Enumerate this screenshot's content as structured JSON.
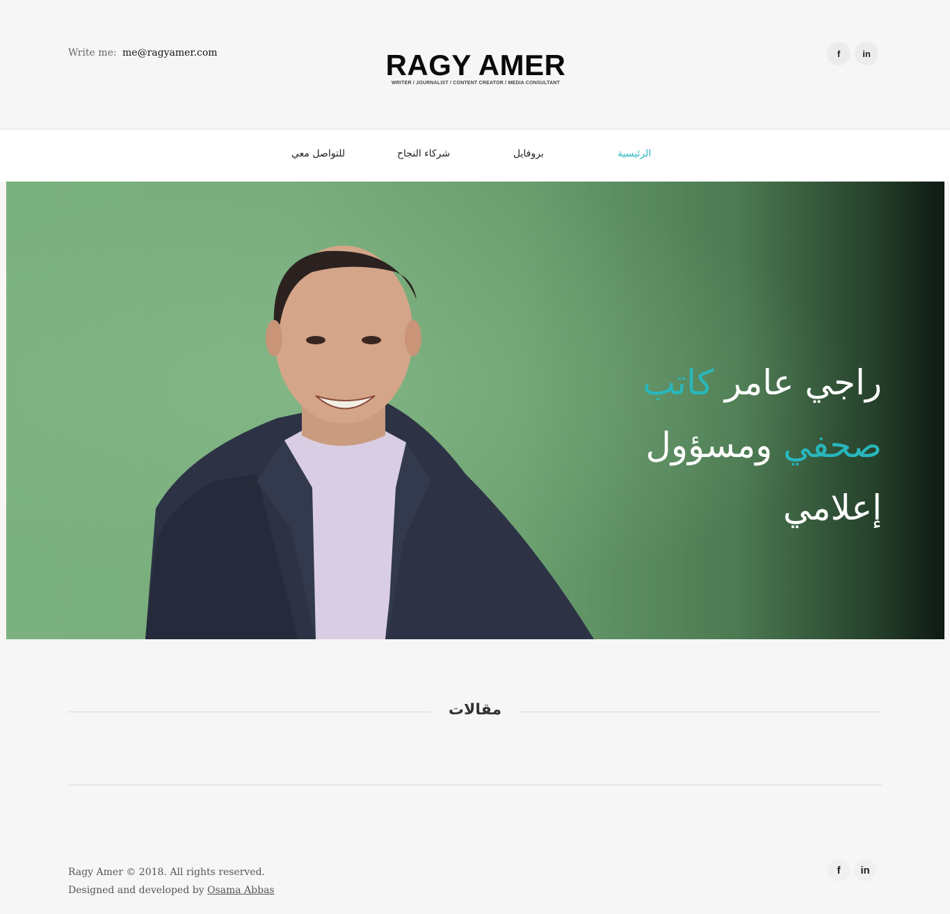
{
  "header": {
    "write_me_label": "Write me:",
    "email": "me@ragyamer.com",
    "logo_name": "RAGY AMER",
    "logo_tagline": "WRITER / JOURNALIST / CONTENT CREATOR / MEDIA CONSULTANT",
    "social": {
      "facebook": "f",
      "linkedin": "in"
    }
  },
  "nav": {
    "items": [
      {
        "label": "الرئيسية",
        "active": true
      },
      {
        "label": "بروفايل",
        "active": false
      },
      {
        "label": "شركاء النجاح",
        "active": false
      },
      {
        "label": "للتواصل معي",
        "active": false
      }
    ]
  },
  "hero": {
    "line1_part1": "راجي عامر",
    "line1_part2": "كاتب",
    "line2_part1": "صحفي",
    "line2_part2": "ومسؤول",
    "line3": "إعلامي",
    "accent_color": "#28b7bd"
  },
  "section": {
    "title": "مقالات"
  },
  "footer": {
    "copyright": "Ragy Amer © 2018. All rights reserved.",
    "credit_prefix": "Designed and developed by",
    "credit_name": "Osama Abbas",
    "social": {
      "facebook": "f",
      "linkedin": "in"
    }
  }
}
